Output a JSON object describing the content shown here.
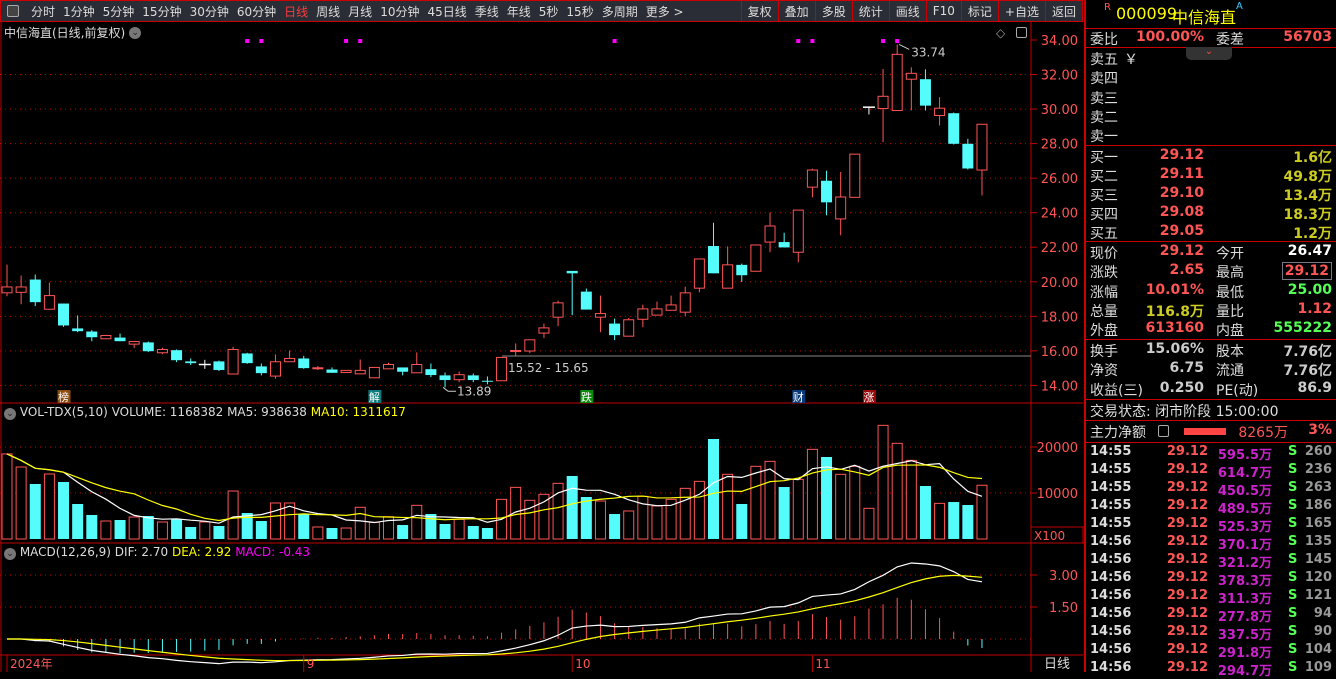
{
  "toolbar": {
    "periods": [
      "分时",
      "1分钟",
      "5分钟",
      "15分钟",
      "30分钟",
      "60分钟",
      "日线",
      "周线",
      "月线",
      "10分钟",
      "45日线",
      "季线",
      "年线",
      "5秒",
      "15秒",
      "多周期",
      "更多 >"
    ],
    "active": "日线",
    "buttons": [
      "复权",
      "叠加",
      "多股",
      "统计",
      "画线",
      "F10",
      "标记",
      "+自选",
      "返回"
    ]
  },
  "chart_title": "中信海直(日线,前复权)",
  "colors": {
    "up": "#ff5555",
    "down": "#54fcfc",
    "grid": "#c00000",
    "axis": "#ff5555",
    "ma5": "#ffffff",
    "ma10": "#ffff00",
    "macd_label": "#ff00ff"
  },
  "chart_data": [
    {
      "type": "candlestick",
      "yticks": [
        "34.00",
        "32.00",
        "30.00",
        "28.00",
        "26.00",
        "24.00",
        "22.00",
        "20.00",
        "18.00",
        "16.00",
        "14.00"
      ],
      "ylim": [
        14,
        34
      ],
      "ohlc": [
        [
          19.36,
          20.99,
          19.16,
          19.7
        ],
        [
          19.39,
          20.36,
          18.7,
          19.7
        ],
        [
          20.13,
          20.42,
          18.59,
          18.82
        ],
        [
          18.41,
          19.95,
          18.41,
          19.2
        ],
        [
          18.74,
          18.74,
          17.39,
          17.47
        ],
        [
          17.3,
          18.05,
          17.08,
          17.14
        ],
        [
          17.12,
          17.2,
          16.56,
          16.79
        ],
        [
          16.7,
          16.93,
          16.68,
          16.89
        ],
        [
          16.77,
          17.0,
          16.56,
          16.56
        ],
        [
          16.39,
          16.56,
          16.16,
          16.54
        ],
        [
          16.49,
          16.54,
          15.93,
          15.98
        ],
        [
          15.89,
          16.18,
          15.81,
          16.08
        ],
        [
          16.04,
          16.08,
          15.35,
          15.46
        ],
        [
          15.39,
          15.56,
          15.18,
          15.29
        ],
        [
          15.21,
          15.48,
          14.96,
          15.21
        ],
        [
          15.39,
          15.44,
          14.83,
          14.89
        ],
        [
          14.66,
          16.24,
          14.66,
          16.08
        ],
        [
          15.85,
          15.89,
          15.25,
          15.29
        ],
        [
          15.1,
          15.27,
          14.58,
          14.71
        ],
        [
          14.54,
          15.79,
          14.39,
          15.37
        ],
        [
          15.37,
          16.02,
          15.37,
          15.56
        ],
        [
          15.56,
          15.71,
          14.96,
          15.0
        ],
        [
          14.98,
          15.12,
          14.89,
          15.02
        ],
        [
          14.92,
          15.04,
          14.73,
          14.73
        ],
        [
          14.75,
          14.87,
          14.73,
          14.87
        ],
        [
          14.67,
          15.5,
          14.67,
          14.87
        ],
        [
          14.44,
          15.04,
          14.44,
          15.04
        ],
        [
          14.96,
          15.31,
          14.96,
          15.21
        ],
        [
          15.04,
          15.04,
          14.58,
          14.79
        ],
        [
          14.73,
          15.91,
          14.73,
          15.21
        ],
        [
          14.94,
          15.27,
          14.48,
          14.6
        ],
        [
          14.58,
          14.75,
          13.89,
          14.31
        ],
        [
          14.33,
          14.81,
          14.19,
          14.62
        ],
        [
          14.58,
          14.69,
          14.19,
          14.31
        ],
        [
          14.27,
          14.52,
          14.06,
          14.25
        ],
        [
          14.27,
          15.65,
          14.27,
          15.62
        ],
        [
          15.96,
          16.43,
          15.73,
          16.02
        ],
        [
          15.99,
          16.64,
          15.87,
          16.64
        ],
        [
          17.03,
          17.58,
          16.74,
          17.33
        ],
        [
          17.95,
          18.91,
          17.43,
          18.78
        ],
        [
          20.63,
          20.63,
          18.07,
          20.49
        ],
        [
          19.43,
          19.61,
          18.39,
          18.39
        ],
        [
          17.95,
          19.2,
          17.08,
          18.16
        ],
        [
          17.58,
          17.87,
          16.62,
          16.91
        ],
        [
          16.85,
          17.9,
          16.85,
          17.8
        ],
        [
          17.83,
          18.68,
          17.37,
          18.43
        ],
        [
          18.07,
          18.85,
          18.07,
          18.43
        ],
        [
          18.35,
          19.2,
          18.35,
          18.66
        ],
        [
          18.24,
          19.72,
          18.01,
          19.36
        ],
        [
          19.63,
          21.32,
          19.39,
          21.32
        ],
        [
          22.07,
          23.42,
          20.49,
          20.49
        ],
        [
          19.63,
          22.05,
          19.63,
          20.98
        ],
        [
          20.98,
          21.05,
          19.99,
          20.38
        ],
        [
          20.61,
          22.13,
          20.61,
          22.13
        ],
        [
          22.3,
          24.0,
          21.71,
          23.23
        ],
        [
          22.3,
          22.84,
          21.99,
          21.99
        ],
        [
          21.71,
          24.15,
          21.13,
          24.15
        ],
        [
          25.48,
          26.55,
          24.89,
          26.47
        ],
        [
          25.85,
          26.43,
          23.85,
          24.6
        ],
        [
          23.64,
          26.36,
          22.69,
          24.91
        ],
        [
          24.89,
          27.39,
          24.89,
          27.39
        ],
        [
          30.11,
          30.11,
          29.69,
          30.11
        ],
        [
          30.03,
          32.32,
          28.09,
          30.74
        ],
        [
          29.92,
          33.74,
          29.92,
          33.17
        ],
        [
          31.73,
          32.42,
          29.92,
          32.07
        ],
        [
          31.73,
          32.3,
          29.92,
          30.2
        ],
        [
          29.63,
          30.69,
          29.05,
          30.05
        ],
        [
          29.76,
          29.8,
          27.95,
          27.99
        ],
        [
          27.99,
          28.28,
          26.5,
          26.56
        ],
        [
          26.47,
          29.12,
          25.0,
          29.12
        ]
      ],
      "annotations": {
        "high": "33.74",
        "low": "13.89",
        "range": "15.52 - 15.65"
      },
      "flags": [
        {
          "index": 4,
          "text": "榜",
          "color": "#8b4a10"
        },
        {
          "index": 26,
          "text": "解",
          "color": "#0a7a7a"
        },
        {
          "index": 41,
          "text": "跌",
          "color": "#0a8a0a"
        },
        {
          "index": 56,
          "text": "财",
          "color": "#0a3a7a"
        },
        {
          "index": 61,
          "text": "涨",
          "color": "#9a0a0a"
        }
      ],
      "event_markers": [
        17,
        18,
        24,
        25,
        43,
        56,
        57,
        62,
        63
      ],
      "xticks": [
        {
          "index": 0,
          "label": "2024年"
        },
        {
          "index": 21,
          "label": "9"
        },
        {
          "index": 40,
          "label": "10"
        },
        {
          "index": 57,
          "label": "11"
        }
      ],
      "period_label": "日线"
    },
    {
      "type": "bar",
      "name": "VOL-TDX(5,10)",
      "label": "VOL-TDX(5,10)",
      "volume_label": "VOLUME: 1168382",
      "ma5_label": "MA5: 938638",
      "ma10_label": "MA10: 1311617",
      "unit": "X100",
      "yticks": [
        "20000",
        "10000"
      ],
      "ylim": [
        0,
        24000
      ],
      "values": [
        18500,
        15650,
        11960,
        14130,
        12390,
        7610,
        5220,
        3910,
        4130,
        4780,
        5000,
        3700,
        4350,
        2610,
        3700,
        2830,
        10430,
        5650,
        3910,
        7830,
        7830,
        5430,
        2610,
        2390,
        2390,
        6890,
        3620,
        4850,
        3040,
        7320,
        5430,
        3260,
        4280,
        2830,
        2390,
        8620,
        11230,
        8410,
        9710,
        12100,
        13700,
        9130,
        8260,
        5430,
        6090,
        9280,
        7170,
        8620,
        11010,
        12530,
        21740,
        14060,
        7610,
        15800,
        16880,
        11300,
        12970,
        19490,
        17830,
        14060,
        15800,
        6670,
        24710,
        20800,
        17100,
        11520,
        7750,
        8040,
        7390,
        11684
      ]
    },
    {
      "type": "line",
      "label": "MACD(12,26,9)",
      "dif_label": "DIF: 2.70",
      "dea_label": "DEA: 2.92",
      "macd_label": "MACD: -0.43",
      "yticks": [
        "3.00",
        "1.50"
      ]
    }
  ],
  "quote": {
    "flag": "R",
    "code": "000099",
    "name": "中信海直",
    "suffix": "A",
    "weibi_label": "委比",
    "weibi": "100.00%",
    "weicha_label": "委差",
    "weicha": "56703",
    "sell": [
      {
        "label": "卖五",
        "extra": "￥"
      },
      {
        "label": "卖四"
      },
      {
        "label": "卖三"
      },
      {
        "label": "卖二"
      },
      {
        "label": "卖一"
      }
    ],
    "buy": [
      {
        "label": "买一",
        "price": "29.12",
        "vol": "1.6亿"
      },
      {
        "label": "买二",
        "price": "29.11",
        "vol": "49.8万"
      },
      {
        "label": "买三",
        "price": "29.10",
        "vol": "13.4万"
      },
      {
        "label": "买四",
        "price": "29.08",
        "vol": "18.3万"
      },
      {
        "label": "买五",
        "price": "29.05",
        "vol": "1.2万"
      }
    ],
    "stats": [
      {
        "l1": "现价",
        "v1": "29.12",
        "c1": "#ff5555",
        "l2": "今开",
        "v2": "26.47",
        "c2": "#ffffff"
      },
      {
        "l1": "涨跌",
        "v1": "2.65",
        "c1": "#ff5555",
        "l2": "最高",
        "v2": "29.12",
        "c2": "#ff5555"
      },
      {
        "l1": "涨幅",
        "v1": "10.01%",
        "c1": "#ff5555",
        "l2": "最低",
        "v2": "25.00",
        "c2": "#55ff55"
      },
      {
        "l1": "总量",
        "v1": "116.8万",
        "c1": "#cccc22",
        "l2": "量比",
        "v2": "1.12",
        "c2": "#ff5555"
      },
      {
        "l1": "外盘",
        "v1": "613160",
        "c1": "#ff5555",
        "l2": "内盘",
        "v2": "555222",
        "c2": "#55ff55"
      }
    ],
    "stats2": [
      {
        "l1": "换手",
        "v1": "15.06%",
        "l2": "股本",
        "v2": "7.76亿"
      },
      {
        "l1": "净资",
        "v1": "6.75",
        "l2": "流通",
        "v2": "7.76亿"
      },
      {
        "l1": "收益(三)",
        "v1": "0.250",
        "l2": "PE(动)",
        "v2": "86.9"
      }
    ],
    "status": "交易状态: 闭市阶段 15:00:00",
    "main_flow_label": "主力净额",
    "main_flow": "8265万",
    "main_flow_pct": "3%",
    "trades": [
      [
        "14:55",
        "29.12",
        "595.5万",
        "S",
        "260"
      ],
      [
        "14:55",
        "29.12",
        "614.7万",
        "S",
        "236"
      ],
      [
        "14:55",
        "29.12",
        "450.5万",
        "S",
        "263"
      ],
      [
        "14:55",
        "29.12",
        "489.5万",
        "S",
        "186"
      ],
      [
        "14:55",
        "29.12",
        "525.3万",
        "S",
        "165"
      ],
      [
        "14:56",
        "29.12",
        "370.1万",
        "S",
        "135"
      ],
      [
        "14:56",
        "29.12",
        "321.2万",
        "S",
        "145"
      ],
      [
        "14:56",
        "29.12",
        "378.3万",
        "S",
        "120"
      ],
      [
        "14:56",
        "29.12",
        "311.3万",
        "S",
        "121"
      ],
      [
        "14:56",
        "29.12",
        "277.8万",
        "S",
        "94"
      ],
      [
        "14:56",
        "29.12",
        "337.5万",
        "S",
        "90"
      ],
      [
        "14:56",
        "29.12",
        "291.8万",
        "S",
        "104"
      ],
      [
        "14:56",
        "29.12",
        "294.7万",
        "S",
        "109"
      ]
    ]
  }
}
